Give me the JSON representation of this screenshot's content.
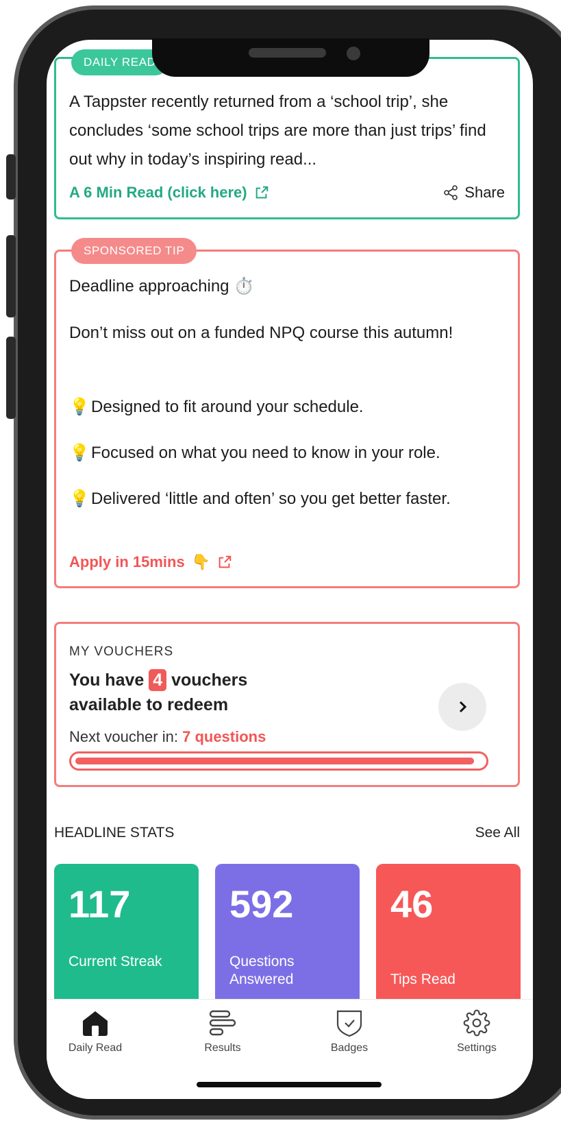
{
  "daily_read": {
    "tag": "DAILY READ",
    "text": "A Tappster recently returned from a ‘school trip’, she concludes ‘some school trips are more than just trips’ find out why in today’s inspiring read...",
    "link_label": "A 6 Min Read (click here)",
    "share_label": "Share"
  },
  "sponsored": {
    "tag": "SPONSORED TIP",
    "heading": "Deadline approaching ⏱️",
    "intro": "Don’t miss out on a funded NPQ course this autumn!",
    "bullets": [
      "Designed to fit around your schedule.",
      "Focused on what you need to know in your role.",
      "Delivered ‘little and often’ so you get better faster."
    ],
    "bullet_emoji": "💡",
    "apply_label": "Apply in 15mins",
    "apply_emoji": "👇"
  },
  "vouchers": {
    "title": "MY VOUCHERS",
    "prefix": "You have",
    "count": "4",
    "suffix_line1": "vouchers",
    "suffix_line2": "available to redeem",
    "next_label": "Next voucher in:",
    "next_value": "7 questions",
    "progress_fraction": 0.98
  },
  "stats": {
    "header": "HEADLINE STATS",
    "see_all": "See All",
    "items": [
      {
        "value": "117",
        "label": "Current Streak"
      },
      {
        "value": "592",
        "label": "Questions Answered"
      },
      {
        "value": "46",
        "label": "Tips Read"
      }
    ]
  },
  "tabbar": {
    "items": [
      {
        "label": "Daily Read",
        "icon": "home-icon"
      },
      {
        "label": "Results",
        "icon": "results-icon"
      },
      {
        "label": "Badges",
        "icon": "badge-icon"
      },
      {
        "label": "Settings",
        "icon": "gear-icon"
      }
    ]
  },
  "colors": {
    "green": "#2fbc91",
    "coral": "#f47c7c",
    "red": "#f25555",
    "purple": "#7c6fe6"
  }
}
